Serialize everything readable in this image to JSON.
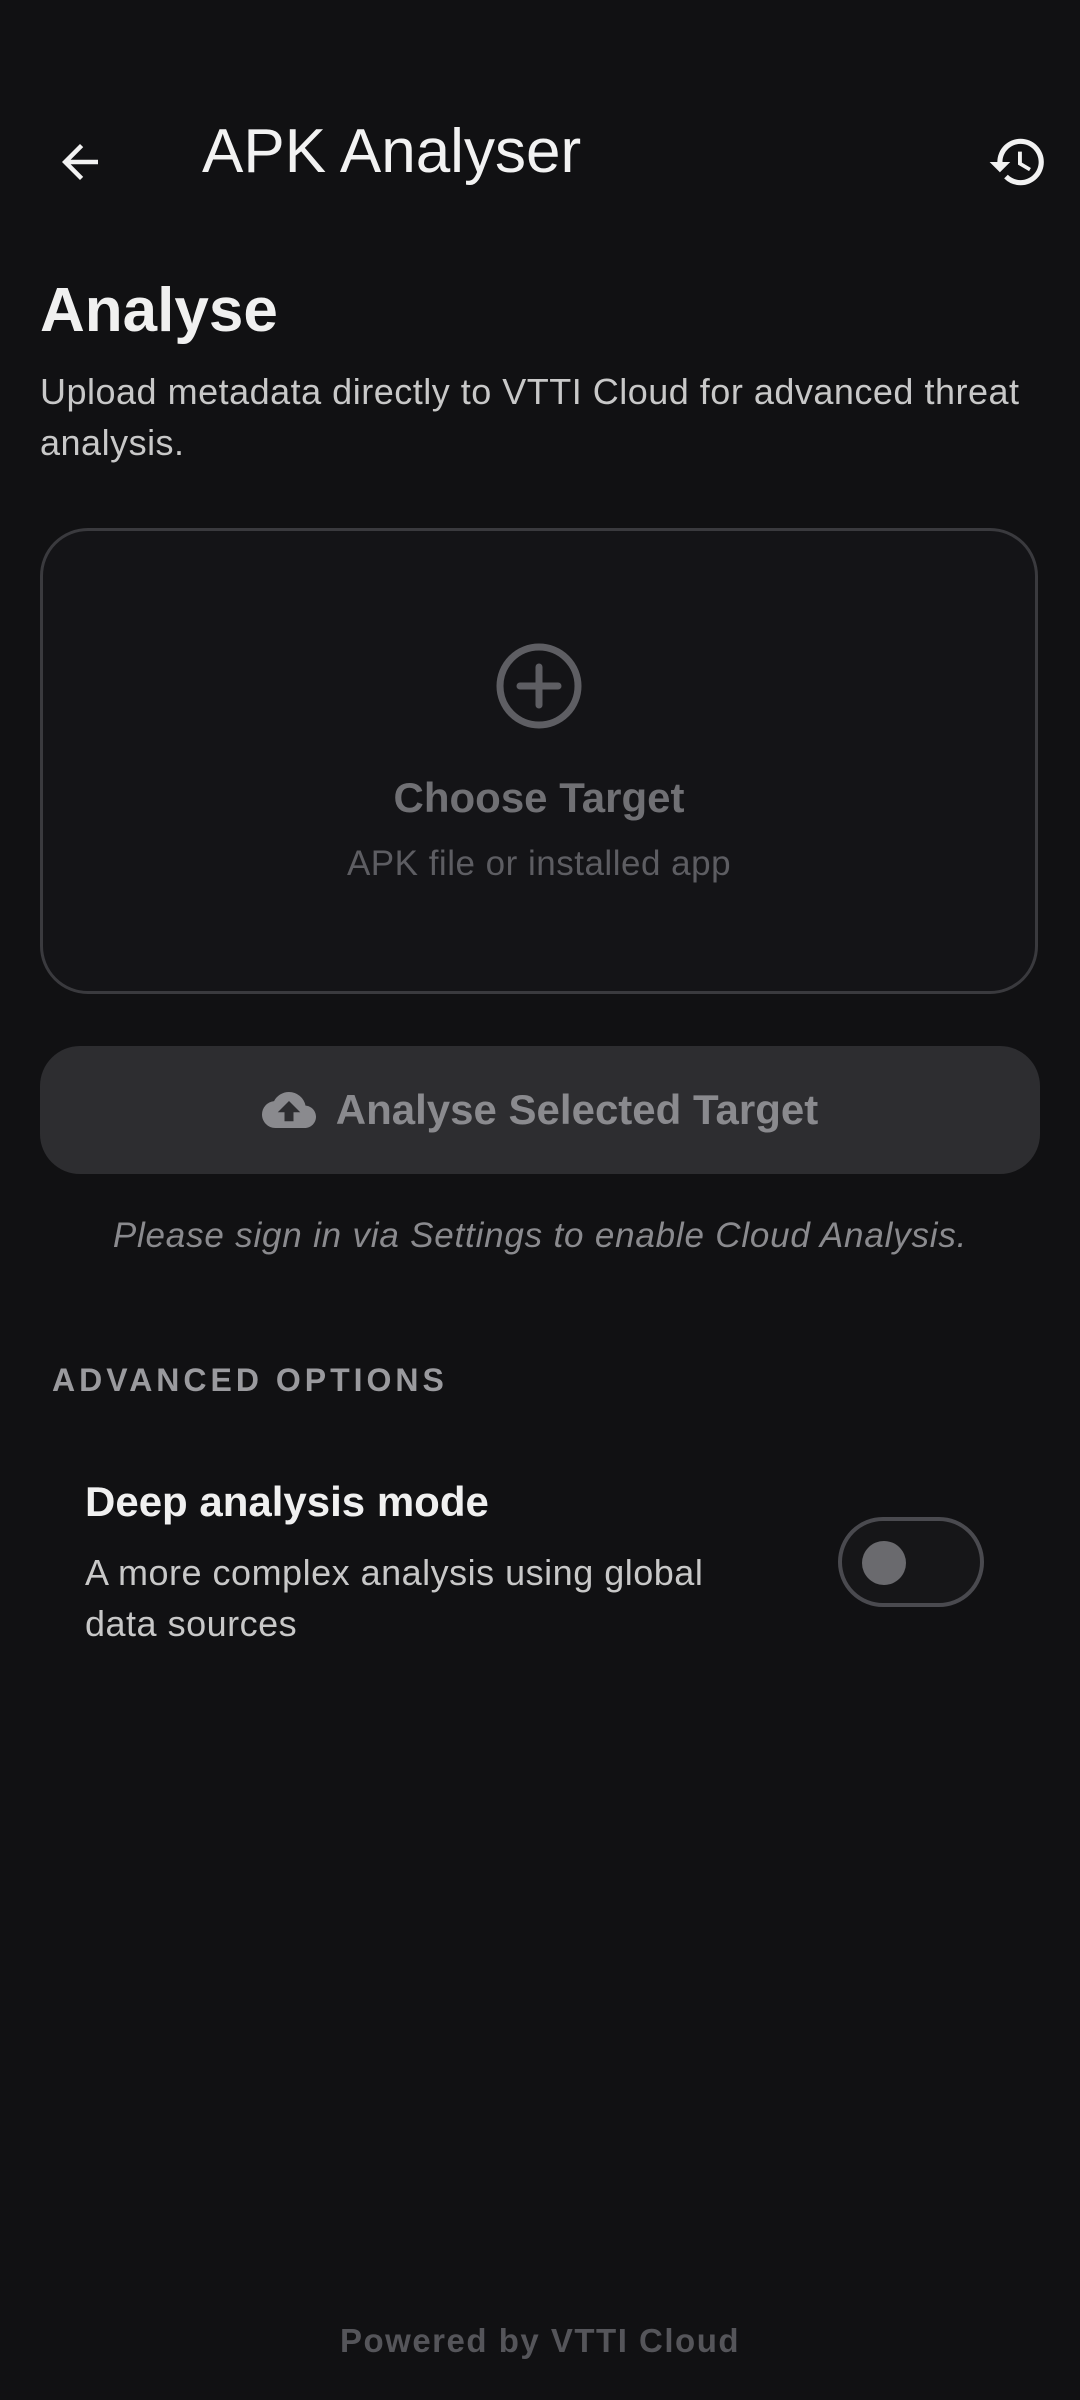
{
  "appbar": {
    "title": "APK Analyser",
    "back_icon": "arrow-left-icon",
    "history_icon": "history-icon"
  },
  "analyse": {
    "title": "Analyse",
    "description": "Upload metadata directly to VTTI Cloud for advanced threat analysis."
  },
  "target_card": {
    "icon": "plus-circle-icon",
    "title": "Choose Target",
    "subtitle": "APK file or installed app"
  },
  "analyse_button": {
    "icon": "cloud-upload-icon",
    "label": "Analyse Selected Target",
    "enabled": false
  },
  "signin_note": "Please sign in via Settings to enable Cloud Analysis.",
  "advanced": {
    "header": "ADVANCED OPTIONS",
    "deep_mode": {
      "title": "Deep analysis mode",
      "description": "A more complex analysis using global data sources",
      "enabled": false
    }
  },
  "footer": "Powered by VTTI Cloud",
  "colors": {
    "background": "#111113",
    "card_border": "#3a3a3e",
    "button_bg": "#2d2d30",
    "text_primary": "#f0f0f0",
    "text_muted": "#8a8a8e"
  }
}
